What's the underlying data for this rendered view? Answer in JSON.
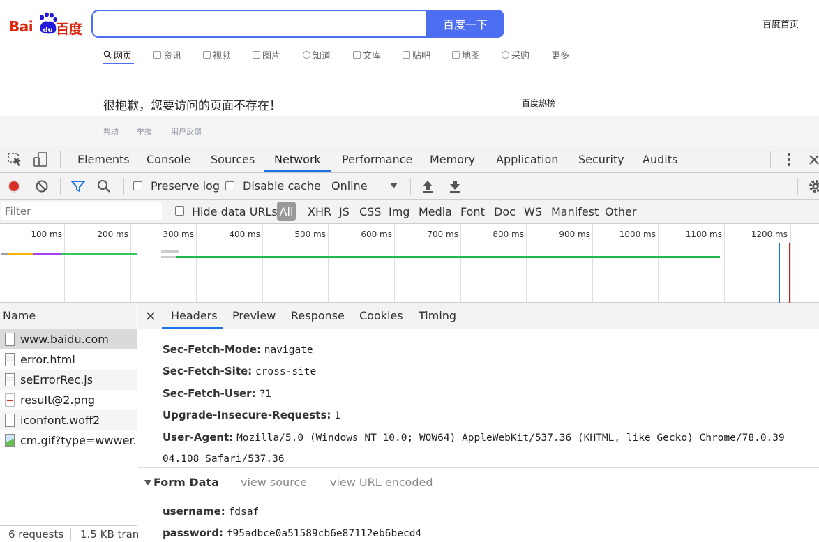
{
  "baidu": {
    "logo_bai": "Bai",
    "logo_du": "du",
    "logo_cn": "百度",
    "search_button": "百度一下",
    "home_link": "百度首页",
    "nav": [
      "网页",
      "资讯",
      "视频",
      "图片",
      "知道",
      "文库",
      "贴吧",
      "地图",
      "采购",
      "更多"
    ],
    "error_message": "很抱歉，您要访问的页面不存在！",
    "hot_list": "百度热榜",
    "footer": [
      "帮助",
      "举报",
      "用户反馈"
    ]
  },
  "devtools": {
    "tabs": [
      "Elements",
      "Console",
      "Sources",
      "Network",
      "Performance",
      "Memory",
      "Application",
      "Security",
      "Audits"
    ],
    "selected_tab": "Network",
    "toolbar": {
      "preserve_log": "Preserve log",
      "disable_cache": "Disable cache",
      "throttle": "Online"
    },
    "filter": {
      "placeholder": "Filter",
      "hide_data_urls": "Hide data URLs",
      "types": [
        "All",
        "XHR",
        "JS",
        "CSS",
        "Img",
        "Media",
        "Font",
        "Doc",
        "WS",
        "Manifest",
        "Other"
      ]
    },
    "timeline_ticks": [
      "100 ms",
      "200 ms",
      "300 ms",
      "400 ms",
      "500 ms",
      "600 ms",
      "700 ms",
      "800 ms",
      "900 ms",
      "1000 ms",
      "1100 ms",
      "1200 ms"
    ],
    "name_header": "Name",
    "requests": [
      "www.baidu.com",
      "error.html",
      "seErrorRec.js",
      "result@2.png",
      "iconfont.woff2",
      "cm.gif?type=wwwer..."
    ],
    "status": {
      "requests": "6 requests",
      "transferred": "1.5 KB tran"
    },
    "detail_tabs": [
      "Headers",
      "Preview",
      "Response",
      "Cookies",
      "Timing"
    ],
    "headers": [
      {
        "key": "Sec-Fetch-Mode:",
        "value": "navigate"
      },
      {
        "key": "Sec-Fetch-Site:",
        "value": "cross-site"
      },
      {
        "key": "Sec-Fetch-User:",
        "value": "?1"
      },
      {
        "key": "Upgrade-Insecure-Requests:",
        "value": "1"
      },
      {
        "key": "User-Agent:",
        "value": "Mozilla/5.0 (Windows NT 10.0; WOW64) AppleWebKit/537.36 (KHTML, like Gecko) Chrome/78.0.39",
        "value_cont": "04.108 Safari/537.36"
      }
    ],
    "form_data": {
      "title": "Form Data",
      "view_source": "view source",
      "view_url_encoded": "view URL encoded",
      "fields": [
        {
          "key": "username:",
          "value": "fdsaf"
        },
        {
          "key": "password:",
          "value": "f95adbce0a51589cb6e87112eb6becd4"
        }
      ]
    }
  }
}
